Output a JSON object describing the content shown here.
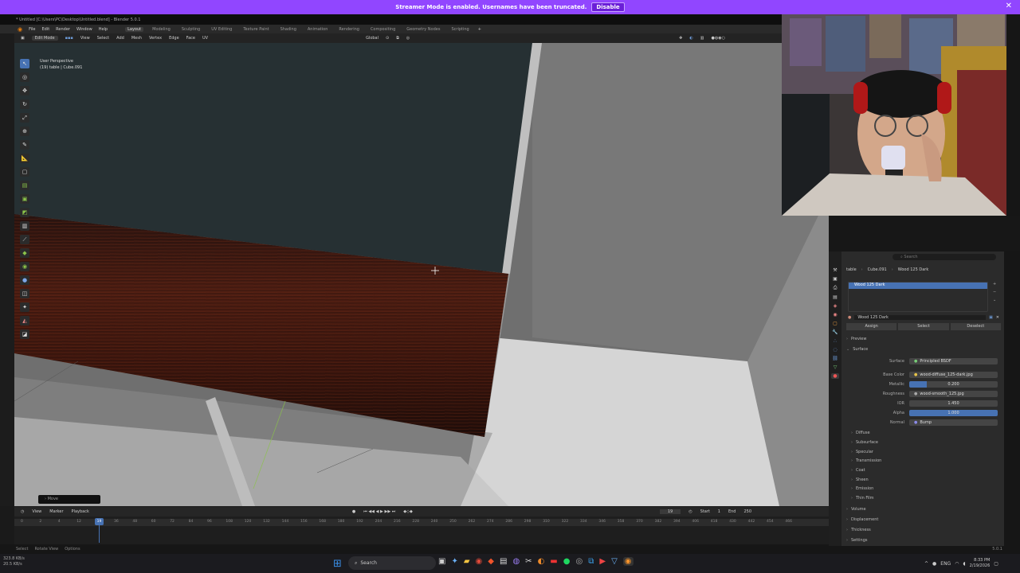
{
  "streamer_bar": {
    "message": "Streamer Mode is enabled. Usernames have been truncated.",
    "button": "Disable",
    "close": "✕"
  },
  "window_title": "* Untitled [C:\\Users\\PC\\Desktop\\Untitled.blend] - Blender 5.0.1",
  "menu": {
    "items": [
      "File",
      "Edit",
      "Render",
      "Window",
      "Help"
    ],
    "workspaces": [
      "Layout",
      "Modeling",
      "Sculpting",
      "UV Editing",
      "Texture Paint",
      "Shading",
      "Animation",
      "Rendering",
      "Compositing",
      "Geometry Nodes",
      "Scripting"
    ],
    "active_workspace": "Layout",
    "plus": "+"
  },
  "header": {
    "mode": "Edit Mode",
    "menus": [
      "View",
      "Select",
      "Add",
      "Mesh",
      "Vertex",
      "Edge",
      "Face",
      "UV"
    ],
    "orientation": "Global"
  },
  "viewport": {
    "info_line1": "User Perspective",
    "info_line2": "(19) table | Cube.091",
    "operator_panel": "Move"
  },
  "timeline": {
    "menus": [
      "View",
      "Marker",
      "Playback"
    ],
    "current_frame": "19",
    "start_label": "Start",
    "start": "1",
    "end_label": "End",
    "end": "250",
    "ticks": [
      "0",
      "2",
      "4",
      "12",
      "24",
      "36",
      "48",
      "60",
      "72",
      "84",
      "96",
      "108",
      "120",
      "132",
      "144",
      "156",
      "168",
      "180",
      "192",
      "204",
      "216",
      "228",
      "240",
      "250",
      "262",
      "274",
      "286",
      "298",
      "310",
      "322",
      "334",
      "346",
      "358",
      "370",
      "382",
      "394",
      "406",
      "418",
      "430",
      "442",
      "454",
      "466"
    ]
  },
  "status_bar": {
    "items": [
      "Select",
      "Rotate View",
      "Options"
    ],
    "version": "5.0.1"
  },
  "network": {
    "up": "323.8 KB/s",
    "down": "20.5 KB/s"
  },
  "properties": {
    "search_placeholder": "Search",
    "breadcrumb": [
      "table",
      "Cube.091",
      "Wood 125 Dark"
    ],
    "slot": "Wood 125 Dark",
    "material_name": "Wood 125 Dark",
    "buttons": [
      "Assign",
      "Select",
      "Deselect"
    ],
    "preview": "Preview",
    "surface_section": "Surface",
    "surface_label": "Surface",
    "surface_value": "Principled BSDF",
    "fields": [
      {
        "label": "Base Color",
        "value": "wood-diffuse_125-dark.jpg",
        "style": "plain"
      },
      {
        "label": "Metallic",
        "value": "0.200",
        "style": "half"
      },
      {
        "label": "Roughness",
        "value": "wood-smooth_125.jpg",
        "style": "plain"
      },
      {
        "label": "IOR",
        "value": "1.450",
        "style": "plain"
      },
      {
        "label": "Alpha",
        "value": "1.000",
        "style": "blue"
      },
      {
        "label": "Normal",
        "value": "Bump",
        "style": "plain"
      }
    ],
    "subsections": [
      "Diffuse",
      "Subsurface",
      "Specular",
      "Transmission",
      "Coat",
      "Sheen",
      "Emission",
      "Thin Film"
    ],
    "sections": [
      "Volume",
      "Displacement",
      "Thickness",
      "Settings"
    ]
  },
  "taskbar": {
    "search": "Search",
    "lang": "ENG",
    "time": "8:33 PM",
    "date": "2/19/2026"
  },
  "colors": {
    "blender_blue": "#4772b3",
    "streamer_purple": "#9146ff",
    "wood": "#4a1a10"
  }
}
